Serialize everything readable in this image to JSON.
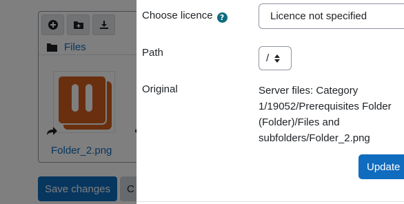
{
  "file_manager": {
    "tools": [
      {
        "icon": "add-file-icon"
      },
      {
        "icon": "create-folder-icon"
      },
      {
        "icon": "download-icon"
      }
    ],
    "path_label": "Files",
    "file": {
      "name": "Folder_2.png",
      "thumbnail_color": "#d35f1f"
    }
  },
  "form_buttons": {
    "save_label": "Save changes",
    "cancel_label": "C"
  },
  "dialog": {
    "licence": {
      "label": "Choose licence",
      "help_glyph": "?",
      "value": "Licence not specified"
    },
    "path": {
      "label": "Path",
      "value": "/"
    },
    "original": {
      "label": "Original",
      "value": "Server files: Category 1/19052/Prerequisites Folder (Folder)/Files and subfolders/Folder_2.png"
    },
    "update_label": "Update"
  },
  "colors": {
    "primary": "#0f6cbf",
    "help_icon": "#0f6c80",
    "text": "#1d2125"
  }
}
